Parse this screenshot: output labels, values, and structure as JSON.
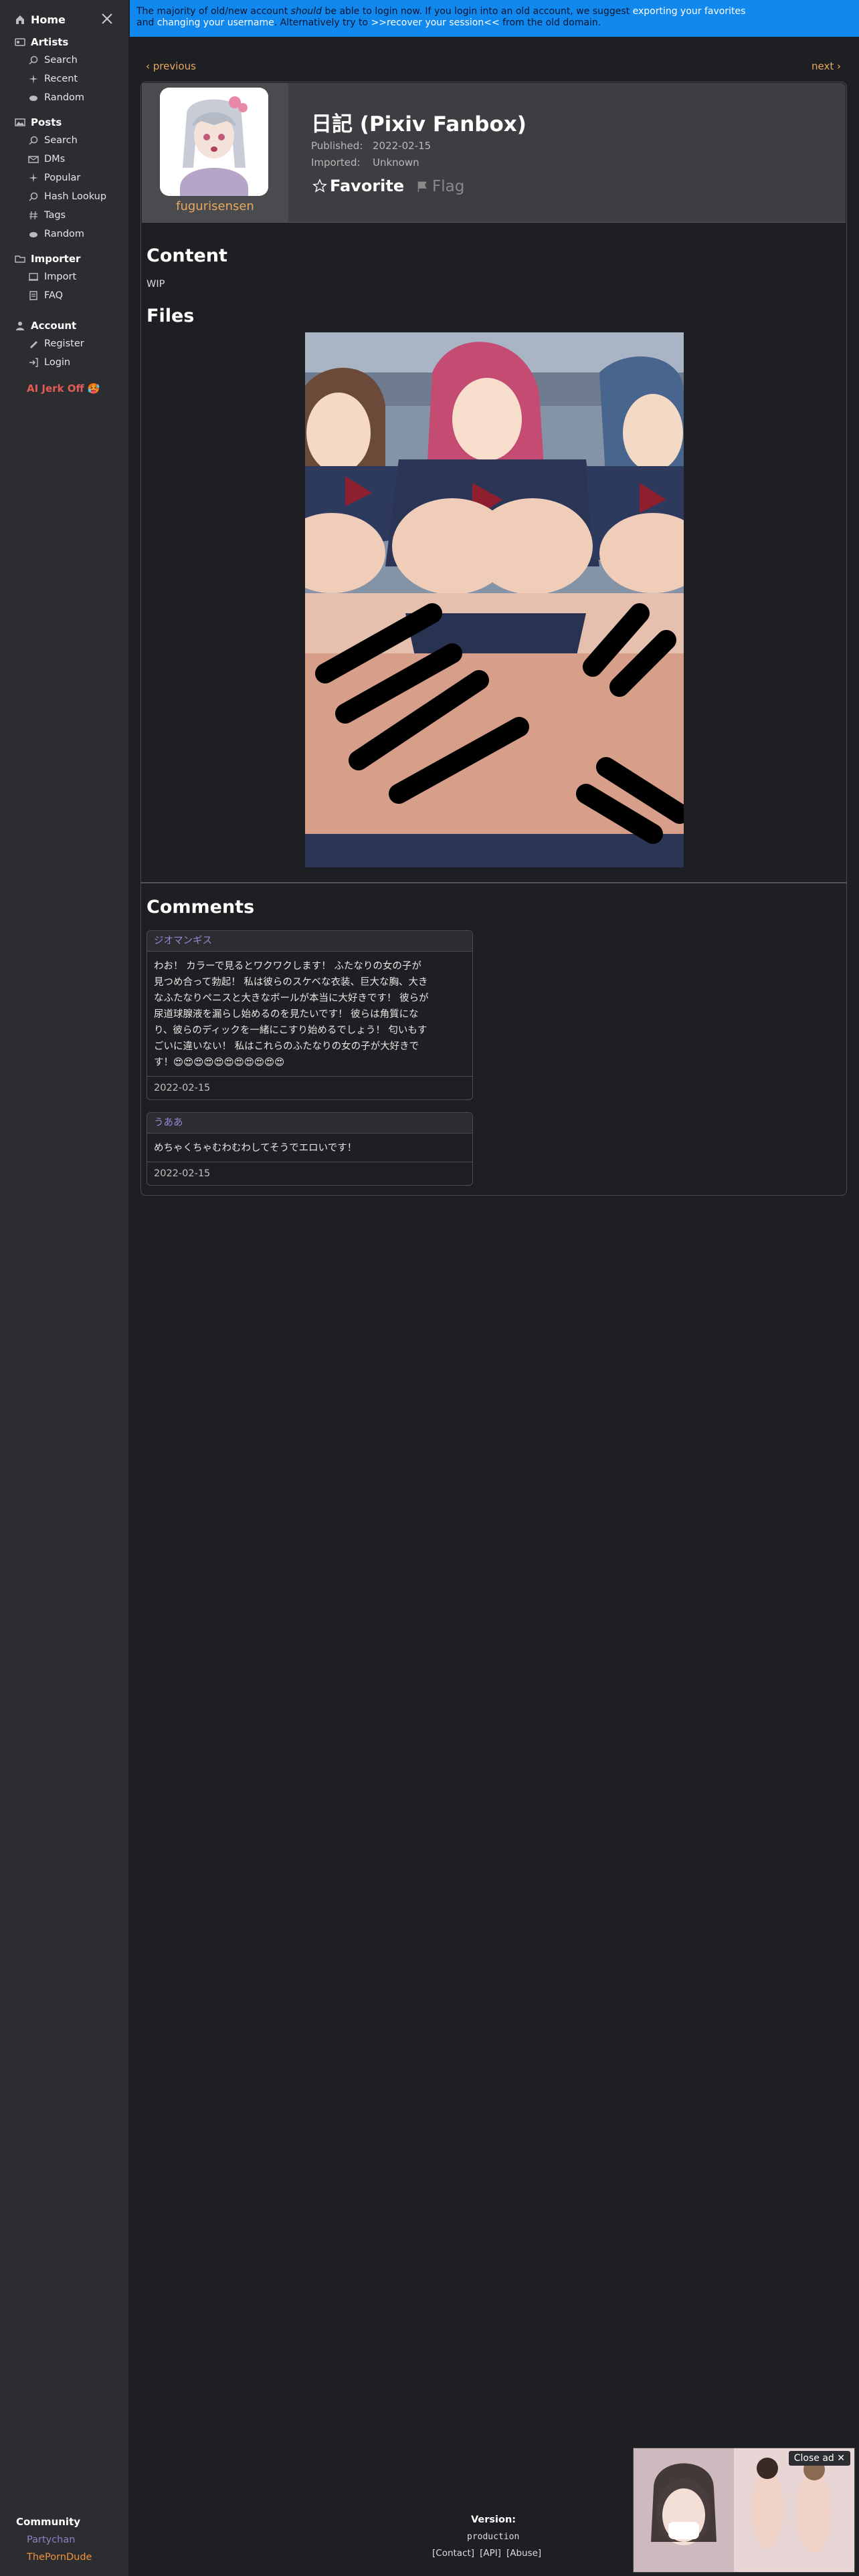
{
  "sidebar": {
    "home": "Home",
    "artists": {
      "label": "Artists",
      "items": [
        "Search",
        "Recent",
        "Random"
      ]
    },
    "posts": {
      "label": "Posts",
      "items": [
        "Search",
        "DMs",
        "Popular",
        "Hash Lookup",
        "Tags",
        "Random"
      ]
    },
    "importer": {
      "label": "Importer",
      "items": [
        "Import",
        "FAQ"
      ]
    },
    "account": {
      "label": "Account",
      "items": [
        "Register",
        "Login"
      ]
    },
    "ai_link": "AI Jerk Off 🥵",
    "community": {
      "label": "Community",
      "links": [
        "Partychan",
        "ThePornDude"
      ]
    }
  },
  "banner": {
    "line1_a": "The majority of old/new account ",
    "line1_em": "should",
    "line1_b": " be able to login now. If you login into an old account, we suggest ",
    "line1_link": "exporting your favorites",
    "line2_a": "and ",
    "line2_link": "changing your username",
    "line2_b": ". Alternatively try to ",
    "line2_link2": ">>recover your session<<",
    "line2_c": " from the old domain."
  },
  "nav": {
    "previous": "‹ previous",
    "next": "next ›"
  },
  "post": {
    "artist": "fugurisensen",
    "title": "日記 (Pixiv Fanbox)",
    "published_label": "Published:",
    "published": "2022-02-15",
    "imported_label": "Imported:",
    "imported": "Unknown",
    "favorite": "Favorite",
    "flag": "Flag",
    "content_heading": "Content",
    "content": "WIP",
    "files_heading": "Files",
    "comments_heading": "Comments"
  },
  "comments": [
    {
      "author": "ジオマンギス",
      "lines": [
        "わお！ カラーで見るとワクワクします！ ふたなりの女の子が",
        "見つめ合って勃起！ 私は彼らのスケベな衣装、巨大な胸、大き",
        "なふたなりペニスと大きなボールが本当に大好きです！ 彼らが",
        "尿道球腺液を漏らし始めるのを見たいです！ 彼らは角質にな",
        "り、彼らのディックを一緒にこすり始めるでしょう！ 匂いもす",
        "ごいに違いない！ 私はこれらのふたなりの女の子が大好きで",
        "す！😍😍😍😍😍😍😍😍😍😍😍"
      ],
      "date": "2022-02-15"
    },
    {
      "author": "うああ",
      "lines": [
        "めちゃくちゃむわむわしてそうでエロいです！"
      ],
      "date": "2022-02-15"
    }
  ],
  "footer": {
    "version_label": "Version:",
    "environment": "production",
    "links": [
      "[Contact]",
      "[API]",
      "[Abuse]"
    ]
  },
  "ad": {
    "close": "Close ad ✕"
  },
  "colors": {
    "accent": "#e8a95f",
    "banner": "#1188ee",
    "comment_author": "#9b86d6",
    "ai_link": "#e35b55"
  }
}
